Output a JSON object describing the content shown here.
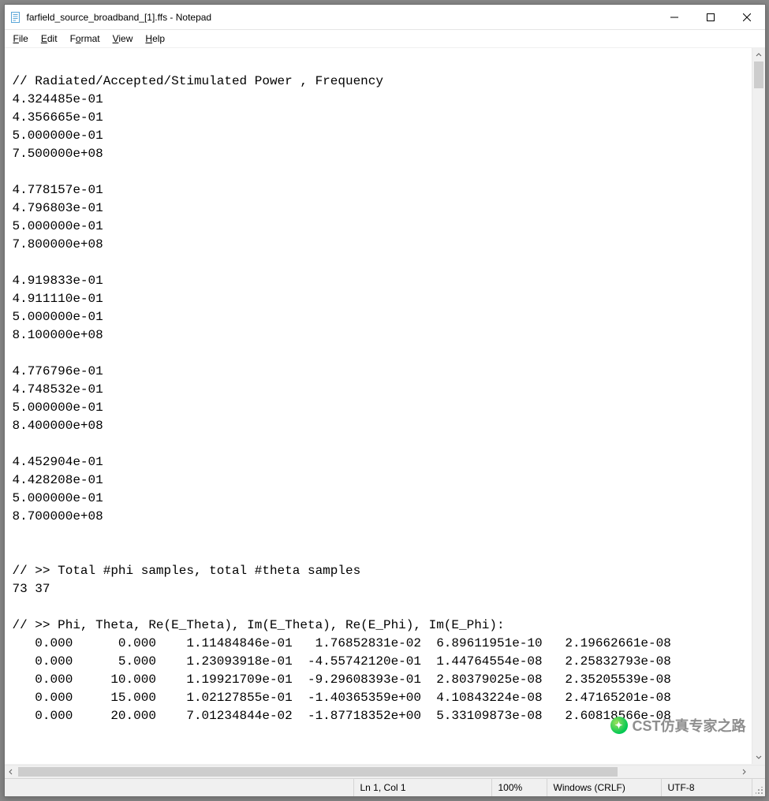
{
  "title": "farfield_source_broadband_[1].ffs - Notepad",
  "menu": {
    "file": "File",
    "edit": "Edit",
    "format": "Format",
    "view": "View",
    "help": "Help"
  },
  "content": "\n// Radiated/Accepted/Stimulated Power , Frequency \n4.324485e-01 \n4.356665e-01 \n5.000000e-01 \n7.500000e+08 \n\n4.778157e-01 \n4.796803e-01 \n5.000000e-01 \n7.800000e+08 \n\n4.919833e-01 \n4.911110e-01 \n5.000000e-01 \n8.100000e+08 \n\n4.776796e-01 \n4.748532e-01 \n5.000000e-01 \n8.400000e+08 \n\n4.452904e-01 \n4.428208e-01 \n5.000000e-01 \n8.700000e+08 \n\n\n// >> Total #phi samples, total #theta samples\n73 37\n\n// >> Phi, Theta, Re(E_Theta), Im(E_Theta), Re(E_Phi), Im(E_Phi): \n   0.000      0.000    1.11484846e-01   1.76852831e-02  6.89611951e-10   2.19662661e-08\n   0.000      5.000    1.23093918e-01  -4.55742120e-01  1.44764554e-08   2.25832793e-08\n   0.000     10.000    1.19921709e-01  -9.29608393e-01  2.80379025e-08   2.35205539e-08\n   0.000     15.000    1.02127855e-01  -1.40365359e+00  4.10843224e-08   2.47165201e-08\n   0.000     20.000    7.01234844e-02  -1.87718352e+00  5.33109873e-08   2.60818566e-08",
  "status": {
    "position": "Ln 1, Col 1",
    "zoom": "100%",
    "line_endings": "Windows (CRLF)",
    "encoding": "UTF-8"
  },
  "watermark": "CST仿真专家之路"
}
